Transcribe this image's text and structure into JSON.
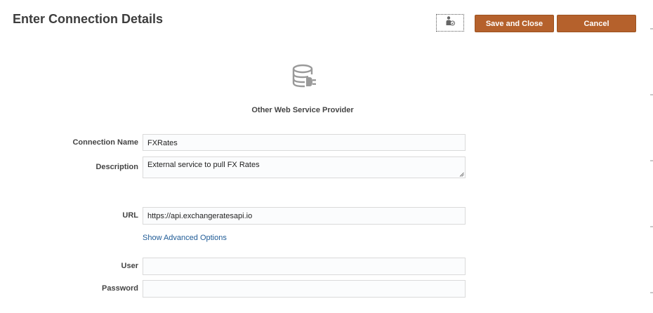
{
  "header": {
    "title": "Enter Connection Details",
    "save_label": "Save and Close",
    "cancel_label": "Cancel",
    "help_icon": "accessibility-person-icon"
  },
  "provider": {
    "icon": "database-plug-icon",
    "label": "Other Web Service Provider"
  },
  "form": {
    "connection_name": {
      "label": "Connection Name",
      "value": "FXRates"
    },
    "description": {
      "label": "Description",
      "value": "External service to pull FX Rates"
    },
    "url": {
      "label": "URL",
      "value": "https://api.exchangeratesapi.io"
    },
    "advanced_link": "Show Advanced Options",
    "user": {
      "label": "User",
      "value": ""
    },
    "password": {
      "label": "Password",
      "value": ""
    }
  },
  "colors": {
    "button_bg": "#b5612c",
    "link": "#1f5b96",
    "title": "#3d3d3d"
  }
}
